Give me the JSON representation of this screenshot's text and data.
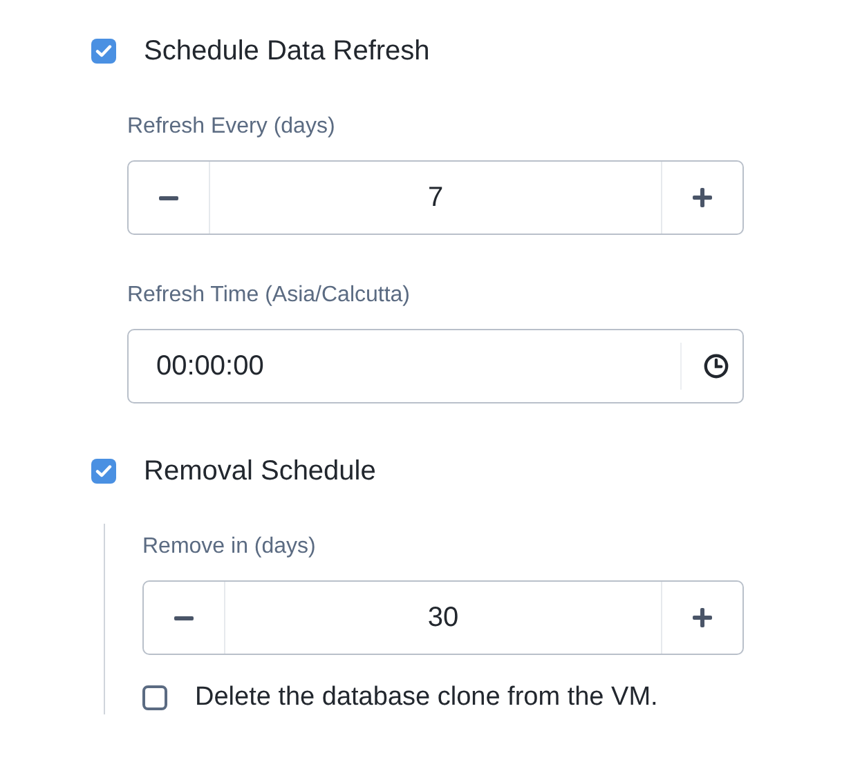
{
  "sections": [
    {
      "checkbox": {
        "label": "Schedule Data Refresh",
        "checked": true
      },
      "ruled": false,
      "fields": [
        {
          "kind": "stepper",
          "label": "Refresh Every (days)",
          "value": "7"
        },
        {
          "kind": "time",
          "label": "Refresh Time (Asia/Calcutta)",
          "value": "00:00:00"
        }
      ]
    },
    {
      "checkbox": {
        "label": "Removal Schedule",
        "checked": true
      },
      "ruled": true,
      "fields": [
        {
          "kind": "stepper",
          "label": "Remove in (days)",
          "value": "30"
        },
        {
          "kind": "checkbox",
          "label": "Delete the database clone from the VM.",
          "checked": false
        }
      ]
    }
  ]
}
